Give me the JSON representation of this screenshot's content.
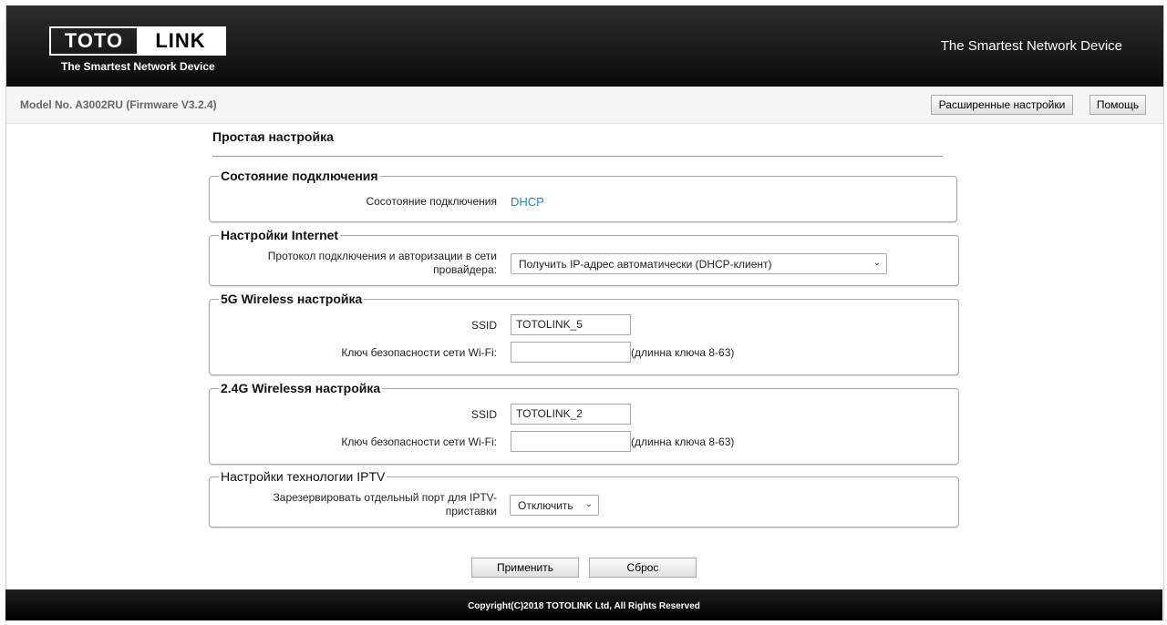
{
  "header": {
    "logo_left": "TOTO",
    "logo_right": "LINK",
    "logo_sub": "The Smartest Network Device",
    "tagline": "The Smartest Network Device"
  },
  "toolbar": {
    "model": "Model No. A3002RU (Firmware V3.2.4)",
    "advanced_label": "Расширенные настройки",
    "help_label": "Помощь"
  },
  "page": {
    "title": "Простая настройка"
  },
  "connection_status": {
    "legend": "Состояние подключения",
    "label": "Сосотояние подключения",
    "value": "DHCP"
  },
  "internet": {
    "legend": "Настройки Internet",
    "protocol_label_1": "Протокол подключения и авторизации в сети",
    "protocol_label_2": "провайдера:",
    "protocol_selected": "Получить IP-адрес автоматически (DHCP-клиент)"
  },
  "wireless_5g": {
    "legend": "5G Wireless настройка",
    "ssid_label": "SSID",
    "ssid_value": "TOTOLINK_5",
    "key_label": "Ключ безопасности сети Wi-Fi:",
    "key_value": "",
    "key_hint": "(длинна ключа 8-63)"
  },
  "wireless_24g": {
    "legend": "2.4G Wirelessя настройка",
    "ssid_label": "SSID",
    "ssid_value": "TOTOLINK_2",
    "key_label": "Ключ безопасности сети Wi-Fi:",
    "key_value": "",
    "key_hint": "(длинна ключа 8-63)"
  },
  "iptv": {
    "legend": "Настройки технологии IPTV",
    "port_label_1": "Зарезервировать отдельный порт для IPTV-",
    "port_label_2": "приставки",
    "port_selected": "Отключить"
  },
  "actions": {
    "apply_label": "Применить",
    "reset_label": "Сброс"
  },
  "footer": {
    "copyright": "Copyright(C)2018 TOTOLINK Ltd, All Rights Reserved"
  },
  "colors": {
    "link": "#1a8fb8",
    "header_bg": "#111111"
  }
}
